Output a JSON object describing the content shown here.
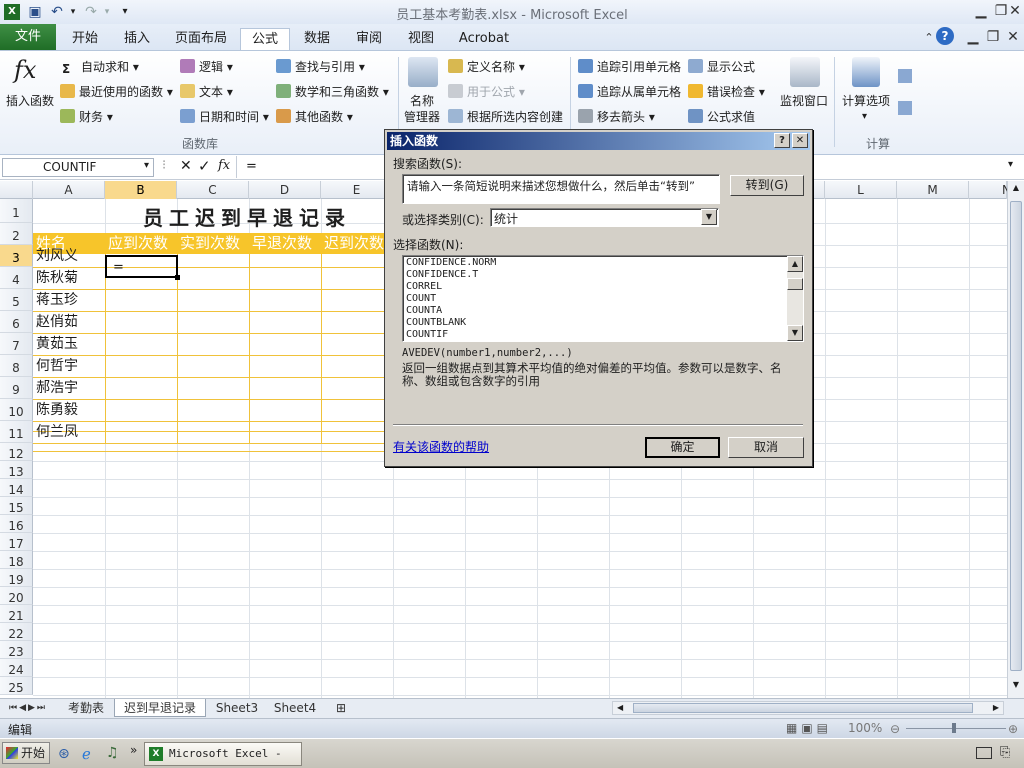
{
  "window": {
    "title": "员工基本考勤表.xlsx - Microsoft Excel"
  },
  "tabs": [
    "文件",
    "开始",
    "插入",
    "页面布局",
    "公式",
    "数据",
    "审阅",
    "视图",
    "Acrobat"
  ],
  "ribbon": {
    "insert_function": "插入函数",
    "autosum": "自动求和",
    "recent": "最近使用的函数",
    "financial": "财务",
    "logical": "逻辑",
    "text": "文本",
    "datetime": "日期和时间",
    "lookup": "查找与引用",
    "math": "数学和三角函数",
    "more": "其他函数",
    "group_library": "函数库",
    "name_manager_1": "名称",
    "name_manager_2": "管理器",
    "define_name": "定义名称",
    "use_in_formula": "用于公式",
    "create_from_sel": "根据所选内容创建",
    "trace_precedents": "追踪引用单元格",
    "trace_dependents": "追踪从属单元格",
    "remove_arrows": "移去箭头",
    "show_formulas": "显示公式",
    "error_check": "错误检查",
    "evaluate": "公式求值",
    "watch": "监视窗口",
    "calc_options": "计算选项",
    "group_calc": "计算"
  },
  "formula_bar": {
    "name_box": "COUNTIF",
    "fx": "fx",
    "formula": "="
  },
  "columns": [
    "A",
    "B",
    "C",
    "D",
    "E",
    "L",
    "M",
    "N"
  ],
  "rows": [
    "1",
    "2",
    "3",
    "4",
    "5",
    "6",
    "7",
    "8",
    "9",
    "10",
    "11",
    "12",
    "13",
    "14",
    "15",
    "16",
    "17",
    "18",
    "19",
    "20",
    "21",
    "22",
    "23",
    "24",
    "25"
  ],
  "sheet": {
    "title": "员工迟到早退记录",
    "headers": [
      "姓名",
      "应到次数",
      "实到次数",
      "早退次数",
      "迟到次数"
    ],
    "names": [
      "刘风义",
      "陈秋菊",
      "蒋玉珍",
      "赵俏茹",
      "黄茹玉",
      "何哲宇",
      "郝浩宇",
      "陈勇毅",
      "何兰凤"
    ],
    "active_cell_value": "="
  },
  "sheet_tabs": [
    "考勤表",
    "迟到早退记录",
    "Sheet3",
    "Sheet4"
  ],
  "status": {
    "mode": "编辑",
    "zoom": "100%"
  },
  "taskbar": {
    "start": "开始",
    "excel_item": "Microsoft Excel - ..."
  },
  "dialog": {
    "title": "插入函数",
    "search_label": "搜索函数(S):",
    "search_placeholder": "请输入一条简短说明来描述您想做什么，然后单击“转到”",
    "go_button": "转到(G)",
    "category_label": "或选择类别(C):",
    "category_value": "统计",
    "select_label": "选择函数(N):",
    "functions": [
      "CONFIDENCE.NORM",
      "CONFIDENCE.T",
      "CORREL",
      "COUNT",
      "COUNTA",
      "COUNTBLANK",
      "COUNTIF"
    ],
    "selected_function": "COUNTIF",
    "syntax": "AVEDEV(number1,number2,...)",
    "description_1": "返回一组数据点到其算术平均值的绝对偏差的平均值。参数可以是数字、名",
    "description_2": "称、数组或包含数字的引用",
    "help_link": "有关该函数的帮助",
    "ok": "确定",
    "cancel": "取消"
  },
  "colors": {
    "accent_green": "#1f6d26",
    "header_fill": "#f7c52a",
    "dialog_title": "#0a246a"
  }
}
